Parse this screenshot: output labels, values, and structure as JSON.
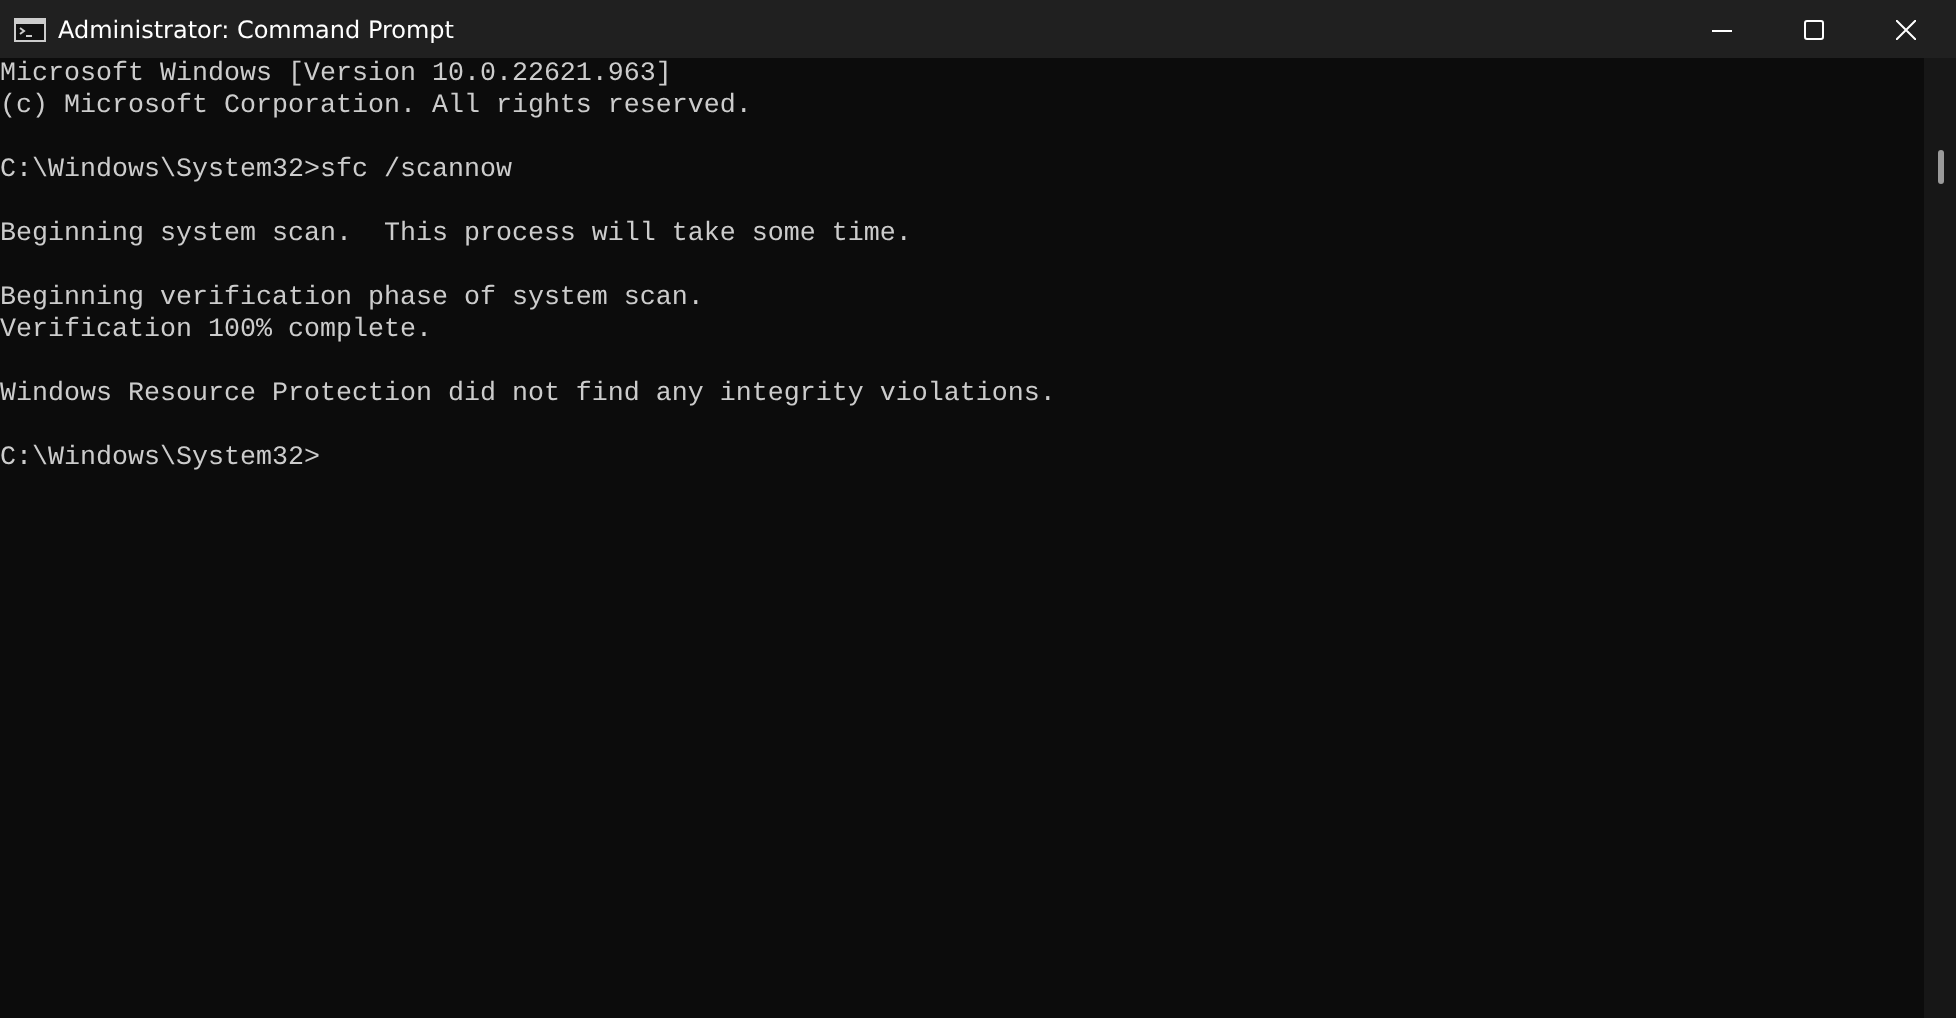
{
  "window": {
    "title": "Administrator: Command Prompt"
  },
  "console": {
    "lines": [
      {
        "kind": "text",
        "text": "Microsoft Windows [Version 10.0.22621.963]"
      },
      {
        "kind": "text",
        "text": "(c) Microsoft Corporation. All rights reserved."
      },
      {
        "kind": "blank"
      },
      {
        "kind": "text",
        "text": "C:\\Windows\\System32>sfc /scannow"
      },
      {
        "kind": "blank"
      },
      {
        "kind": "text",
        "text": "Beginning system scan.  This process will take some time."
      },
      {
        "kind": "blank"
      },
      {
        "kind": "text",
        "text": "Beginning verification phase of system scan."
      },
      {
        "kind": "text",
        "text": "Verification 100% complete."
      },
      {
        "kind": "blank"
      },
      {
        "kind": "text",
        "text": "Windows Resource Protection did not find any integrity violations."
      },
      {
        "kind": "blank"
      },
      {
        "kind": "text",
        "text": "C:\\Windows\\System32>"
      }
    ]
  }
}
